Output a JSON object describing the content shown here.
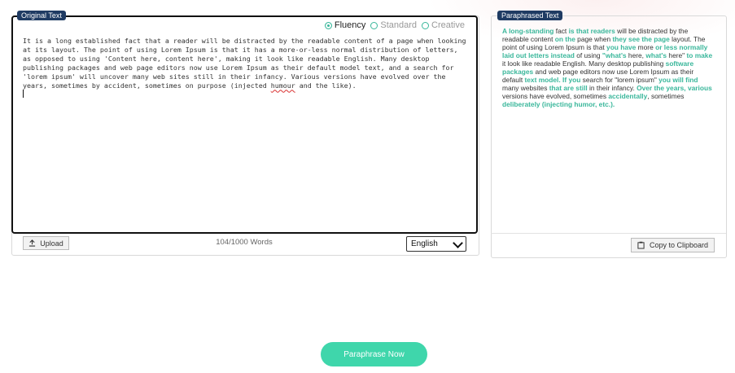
{
  "labels": {
    "original": "Original Text",
    "paraphrased": "Paraphrased Text"
  },
  "modes": [
    {
      "label": "Fluency",
      "active": true
    },
    {
      "label": "Standard",
      "active": false
    },
    {
      "label": "Creative",
      "active": false
    }
  ],
  "original_text": {
    "segments": [
      {
        "text": "It is a long established fact that a reader will be distracted by the readable content of a page when looking at its layout. The point of using Lorem Ipsum is that it has a more-or-less normal distribution of letters, as opposed to using 'Content here, content here', making it look like readable English. Many desktop publishing packages and web page editors now use Lorem Ipsum as their default model text, and a search for 'lorem ipsum' will uncover many web sites still in their infancy. Various versions have evolved over the years, sometimes by accident, sometimes on purpose (injected "
      },
      {
        "text": "humour",
        "misspelled": true
      },
      {
        "text": " and the like)."
      }
    ]
  },
  "toolbar": {
    "upload_label": "Upload",
    "word_count": "104/1000 Words",
    "language": "English",
    "copy_label": "Copy to Clipboard",
    "paraphrase_label": "Paraphrase Now"
  },
  "paraphrased_text": {
    "segments": [
      {
        "text": "A long-standing",
        "hl": true
      },
      {
        "text": " fact "
      },
      {
        "text": "is that readers",
        "hl": true
      },
      {
        "text": " will be distracted by the readable content "
      },
      {
        "text": "on the",
        "hl": true
      },
      {
        "text": " page when "
      },
      {
        "text": "they see the page",
        "hl": true
      },
      {
        "text": " layout. The point of using Lorem Ipsum is that "
      },
      {
        "text": "you have",
        "hl": true
      },
      {
        "text": " more "
      },
      {
        "text": "or less normally laid out letters instead",
        "hl": true
      },
      {
        "text": " of using "
      },
      {
        "text": "\"what's",
        "hl": true
      },
      {
        "text": " here, "
      },
      {
        "text": "what's",
        "hl": true
      },
      {
        "text": " here\" "
      },
      {
        "text": "to make",
        "hl": true
      },
      {
        "text": " it look like readable English. Many desktop publishing "
      },
      {
        "text": "software packages",
        "hl": true
      },
      {
        "text": " and web page editors now use Lorem Ipsum as their default "
      },
      {
        "text": "text model. If you",
        "hl": true
      },
      {
        "text": " search for \"lorem ipsum\" "
      },
      {
        "text": "you will find",
        "hl": true
      },
      {
        "text": " many websites "
      },
      {
        "text": "that are still",
        "hl": true
      },
      {
        "text": " in their infancy. "
      },
      {
        "text": "Over the years, various",
        "hl": true
      },
      {
        "text": " versions have evolved, sometimes "
      },
      {
        "text": "accidentally",
        "hl": true
      },
      {
        "text": ", sometimes "
      },
      {
        "text": "deliberately (injecting humor, etc.).",
        "hl": true
      }
    ]
  },
  "colors": {
    "accent": "#3ab79b",
    "button": "#3fd6ab",
    "label_bg": "#1f3b63"
  }
}
